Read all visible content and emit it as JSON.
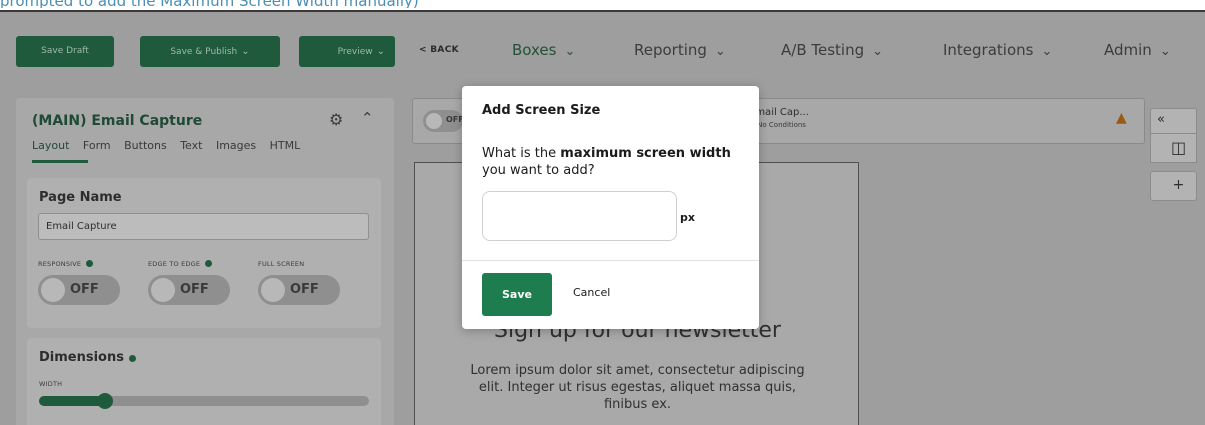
{
  "caption": "prompted to add the Maximum Screen Width manually)",
  "topbar": {
    "save_draft": "Save Draft",
    "save_publish": "Save & Publish",
    "preview": "Preview",
    "back": "< BACK",
    "nav": [
      "Boxes",
      "Reporting",
      "A/B Testing",
      "Integrations",
      "Admin"
    ]
  },
  "panel": {
    "title": "(MAIN) Email Capture",
    "tabs": [
      "Layout",
      "Form",
      "Buttons",
      "Text",
      "Images",
      "HTML"
    ],
    "page_name_heading": "Page Name",
    "page_name_value": "Email Capture",
    "options": [
      {
        "label": "RESPONSIVE",
        "state": "OFF"
      },
      {
        "label": "EDGE TO EDGE",
        "state": "OFF"
      },
      {
        "label": "FULL SCREEN",
        "state": "OFF"
      }
    ],
    "dimensions_heading": "Dimensions",
    "width_label": "WIDTH",
    "width_fraction": 0.2
  },
  "canvas_bar": {
    "toggle_label": "OFF",
    "box_name": "Email Cap...",
    "conditions": "No Conditions"
  },
  "side_tools": {
    "collapse": "«",
    "add": "+"
  },
  "preview": {
    "headline": "Sign up for our newsletter",
    "body": "Lorem ipsum dolor sit amet, consectetur adipiscing elit. Integer ut risus egestas, aliquet massa quis, finibus ex."
  },
  "modal": {
    "title": "Add Screen Size",
    "question_pre": "What is the ",
    "question_bold": "maximum screen width",
    "question_post": " you want to add?",
    "input_value": "",
    "unit": "px",
    "save": "Save",
    "cancel": "Cancel"
  },
  "colors": {
    "primary_green": "#1e7d4e",
    "dark_green": "#1f5a3d",
    "warning": "#e8801c"
  },
  "icons": {
    "chevron": "chevron-down-icon",
    "gear": "gear-icon",
    "warning": "warning-icon",
    "responsive": "devices-icon"
  }
}
